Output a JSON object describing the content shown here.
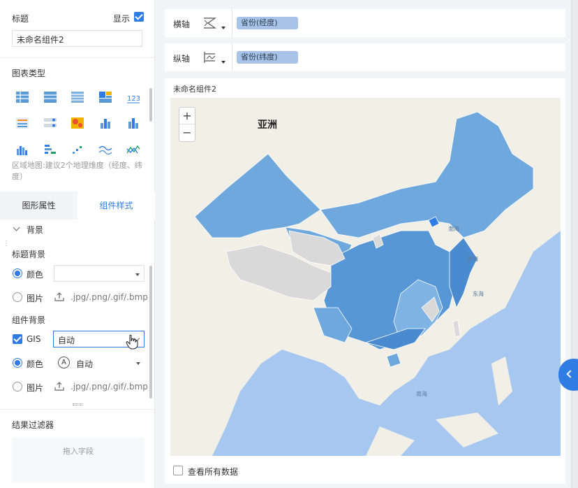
{
  "left": {
    "title_section": {
      "label": "标题",
      "show_label": "显示",
      "title_value": "未命名组件2"
    },
    "chart_type": {
      "label": "图表类型",
      "hint": "区域地图:建议2个地理维度（经度、纬度）",
      "icons": [
        "table-icon",
        "crosstable-icon",
        "detail-table-icon",
        "treemap-icon",
        "number-card-icon",
        "kpi-icon",
        "list-icon",
        "heatmap-icon",
        "stacked-bar-icon",
        "bar-chart-icon",
        "column-icon",
        "grouped-bar-icon",
        "scatter-icon",
        "line-chart-icon",
        "area-line-icon"
      ]
    },
    "tabs": {
      "graph_props": "图形属性",
      "component_style": "组件样式"
    },
    "background": {
      "label": "背景",
      "title_bg": "标题背景",
      "color_label": "颜色",
      "image_label": "图片",
      "image_formats": ".jpg/.png/.gif/.bmp",
      "component_bg": "组件背景",
      "gis_label": "GIS",
      "gis_value": "自动",
      "color2_label": "颜色",
      "color2_value": "自动",
      "image2_label": "图片",
      "image2_formats": ".jpg/.png/.gif/.bmp"
    },
    "filter": {
      "label": "结果过滤器",
      "drop_hint": "拖入字段"
    }
  },
  "right": {
    "x_axis": {
      "label": "横轴",
      "field": "省份(经度)"
    },
    "y_axis": {
      "label": "纵轴",
      "field": "省份(纬度)"
    },
    "chart_title": "未命名组件2",
    "map": {
      "zoom_in": "+",
      "zoom_out": "−",
      "asia_label": "亚洲",
      "labels": [
        "渤海",
        "黄海",
        "东海",
        "南海"
      ]
    },
    "view_all_label": "查看所有数据"
  },
  "colors": {
    "accent": "#2f7ce5",
    "map_region": "#6fa8dc",
    "map_unknown": "#d9d9d9",
    "sea": "#a6c8f0"
  }
}
